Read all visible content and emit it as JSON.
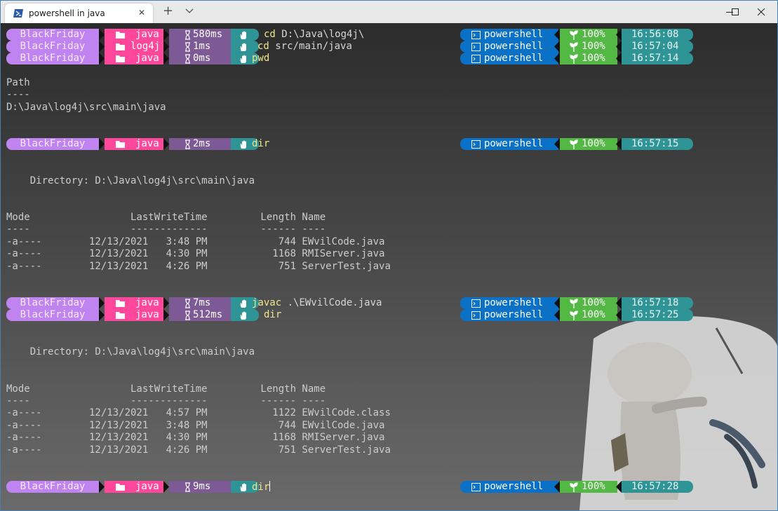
{
  "tab": {
    "title": "powershell in java",
    "close_glyph": "✕",
    "new_tab_glyph": "+"
  },
  "window_controls": [
    "minimize",
    "maximize",
    "close"
  ],
  "colors": {
    "user_segment": "#c084f0",
    "folder_segment": "#ff479c",
    "time_segment": "#7d5a95",
    "status_segment": "#2e9495",
    "shell_segment": "#0a71c6",
    "battery_segment": "#54b845",
    "clock_segment": "#2e9495",
    "command_text": "#f2e68a"
  },
  "prompts": [
    {
      "user": "BlackFriday",
      "folder": "java",
      "duration": "580ms",
      "command": "cd",
      "args": "D:\\Java\\log4j\\",
      "shell": "powershell",
      "battery": "100%",
      "clock": "16:56:08"
    },
    {
      "user": "BlackFriday",
      "folder": "log4j",
      "duration": "1ms",
      "command": "cd",
      "args": "src/main/java",
      "shell": "powershell",
      "battery": "100%",
      "clock": "16:57:04"
    },
    {
      "user": "BlackFriday",
      "folder": "java",
      "duration": "0ms",
      "command": "pwd",
      "args": "",
      "shell": "powershell",
      "battery": "100%",
      "clock": "16:57:14"
    },
    {
      "user": "BlackFriday",
      "folder": "java",
      "duration": "2ms",
      "command": "dir",
      "args": "",
      "shell": "powershell",
      "battery": "100%",
      "clock": "16:57:15"
    },
    {
      "user": "BlackFriday",
      "folder": "java",
      "duration": "7ms",
      "command": "javac",
      "args": ".\\EWvilCode.java",
      "shell": "powershell",
      "battery": "100%",
      "clock": "16:57:18"
    },
    {
      "user": "BlackFriday",
      "folder": "java",
      "duration": "512ms",
      "command": "dir",
      "args": "",
      "shell": "powershell",
      "battery": "100%",
      "clock": "16:57:25"
    },
    {
      "user": "BlackFriday",
      "folder": "java",
      "duration": "9ms",
      "command": "dir",
      "args": "",
      "shell": "powershell",
      "battery": "100%",
      "clock": "16:57:28"
    }
  ],
  "output": {
    "pwd": [
      "Path",
      "----",
      "D:\\Java\\log4j\\src\\main\\java"
    ],
    "dir1": [
      "    Directory: D:\\Java\\log4j\\src\\main\\java",
      "Mode                 LastWriteTime         Length Name",
      "----                 -------------         ------ ----",
      "-a----        12/13/2021   3:48 PM            744 EWvilCode.java",
      "-a----        12/13/2021   4:30 PM           1168 RMIServer.java",
      "-a----        12/13/2021   4:26 PM            751 ServerTest.java"
    ],
    "dir2": [
      "    Directory: D:\\Java\\log4j\\src\\main\\java",
      "Mode                 LastWriteTime         Length Name",
      "----                 -------------         ------ ----",
      "-a----        12/13/2021   4:57 PM           1122 EWvilCode.class",
      "-a----        12/13/2021   3:48 PM            744 EWvilCode.java",
      "-a----        12/13/2021   4:30 PM           1168 RMIServer.java",
      "-a----        12/13/2021   4:26 PM            751 ServerTest.java"
    ]
  }
}
